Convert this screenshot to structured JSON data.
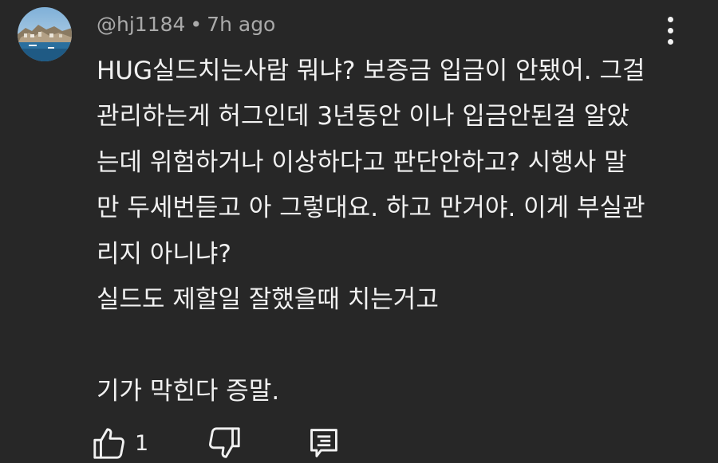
{
  "comment": {
    "author": "@hj1184",
    "separator": "•",
    "time": "7h ago",
    "lines": [
      "HUG실드치는사람 뭐냐? 보증금 입금이 안됐어. 그걸",
      "관리하는게 허그인데 3년동안 이나 입금안된걸 알았",
      "는데 위험하거나 이상하다고 판단안하고? 시행사 말",
      "만 두세번듣고 아 그렇대요. 하고 만거야. 이게 부실관",
      "리지 아니냐?",
      "실드도 제할일 잘했을때 치는거고",
      "",
      "기가 막힌다 증말."
    ]
  },
  "actions": {
    "like_count": "1"
  },
  "icons": {
    "avatar": "avatar",
    "more": "more-vert-icon",
    "like": "thumb-up-icon",
    "dislike": "thumb-down-icon",
    "reply": "reply-icon"
  },
  "colors": {
    "background": "#272727",
    "text": "#f1f1f1",
    "meta": "#aaaaaa"
  }
}
